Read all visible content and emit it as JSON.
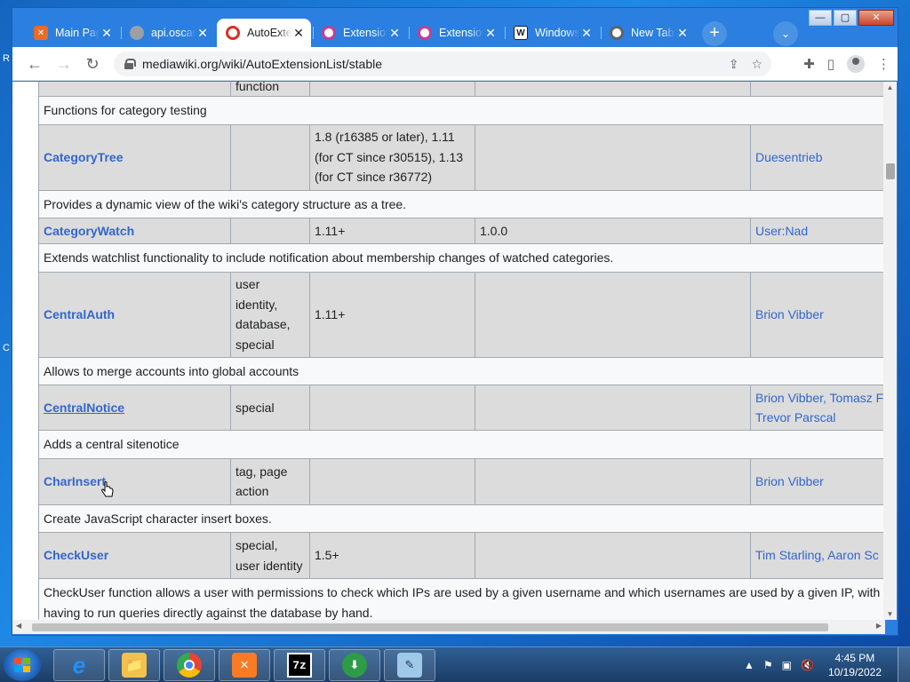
{
  "tabs": [
    {
      "title": "Main Page",
      "icon": "xampp-icon",
      "color": "#e96b28"
    },
    {
      "title": "api.oscar",
      "icon": "globe-icon",
      "color": "#9aa0a6"
    },
    {
      "title": "AutoExtensionList",
      "icon": "mediawiki-icon",
      "color": "#d93025",
      "active": true
    },
    {
      "title": "Extension",
      "icon": "firefox-like-icon",
      "color": "#c63e8f"
    },
    {
      "title": "Extension",
      "icon": "firefox-like-icon",
      "color": "#c63e8f"
    },
    {
      "title": "Windows",
      "icon": "wikipedia-icon",
      "color": "#202124"
    },
    {
      "title": "New Tab",
      "icon": "chrome-icon",
      "color": "#5f6368"
    }
  ],
  "address": "mediawiki.org/wiki/AutoExtensionList/stable",
  "table": {
    "top_partial": {
      "type": "function"
    },
    "rows": [
      {
        "desc": "Functions for category testing"
      },
      {
        "name": "CategoryTree",
        "type": "",
        "version": "1.8 (r16385 or later), 1.11 (for CT since r30515), 1.13 (for CT since r36772)",
        "release": "",
        "author": "Duesentrieb"
      },
      {
        "desc": "Provides a dynamic view of the wiki's category structure as a tree."
      },
      {
        "name": "CategoryWatch",
        "type": "",
        "version": "1.11+",
        "release": "1.0.0",
        "author": "User:Nad"
      },
      {
        "desc": "Extends watchlist functionality to include notification about membership changes of watched categories."
      },
      {
        "name": "CentralAuth",
        "type": "user identity, database, special",
        "version": "1.11+",
        "release": "",
        "author": "Brion Vibber"
      },
      {
        "desc": "Allows to merge accounts into global accounts"
      },
      {
        "name": "CentralNotice",
        "type": "special",
        "version": "",
        "release": "",
        "author_line1": "Brion Vibber, Tomasz F",
        "author_line2": "Trevor Parscal"
      },
      {
        "desc": "Adds a central sitenotice"
      },
      {
        "name": "CharInsert",
        "type": "tag, page action",
        "version": "",
        "release": "",
        "author": "Brion Vibber"
      },
      {
        "desc": "Create JavaScript character insert boxes."
      },
      {
        "name": "CheckUser",
        "type": "special, user identity",
        "version": "1.5+",
        "release": "",
        "author": "Tim Starling, Aaron Sc"
      },
      {
        "desc": "CheckUser function allows a user with permissions to check which IPs are used by a given username and which usernames are used by a given IP, with having to run queries directly against the database by hand."
      }
    ]
  },
  "taskbar": {
    "apps": [
      "Internet Explorer",
      "File Explorer",
      "Google Chrome",
      "XAMPP",
      "7-Zip",
      "Download Manager",
      "Notepad"
    ],
    "app_labels": [
      "e",
      "📁",
      "",
      "✕",
      "7z",
      "⬇",
      "✎"
    ],
    "time": "4:45 PM",
    "date": "10/19/2022"
  }
}
